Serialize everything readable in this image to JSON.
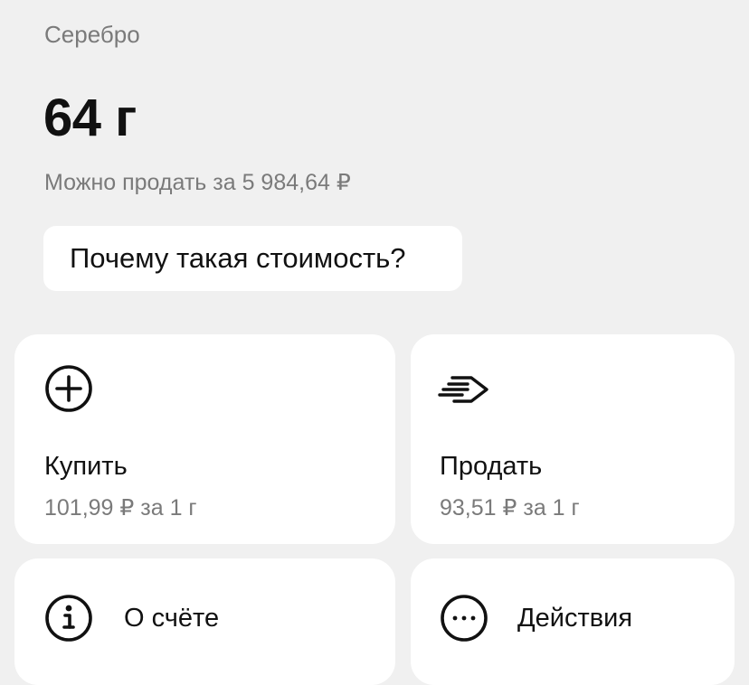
{
  "asset": {
    "name": "Серебро",
    "amount": "64 г",
    "sell_estimate": "Можно продать за 5 984,64 ₽"
  },
  "price_info_button": {
    "label": "Почему такая стоимость?"
  },
  "buy_card": {
    "icon": "plus-circle-icon",
    "title": "Купить",
    "price": "101,99 ₽ за 1 г"
  },
  "sell_card": {
    "icon": "arrow-right-speed-icon",
    "title": "Продать",
    "price": "93,51 ₽ за 1 г"
  },
  "account_card": {
    "icon": "info-circle-icon",
    "label": "О счёте"
  },
  "actions_card": {
    "icon": "more-horizontal-circle-icon",
    "label": "Действия"
  },
  "colors": {
    "background": "#f0f0f0",
    "card": "#ffffff",
    "text_primary": "#111111",
    "text_secondary": "#7a7a7a"
  }
}
